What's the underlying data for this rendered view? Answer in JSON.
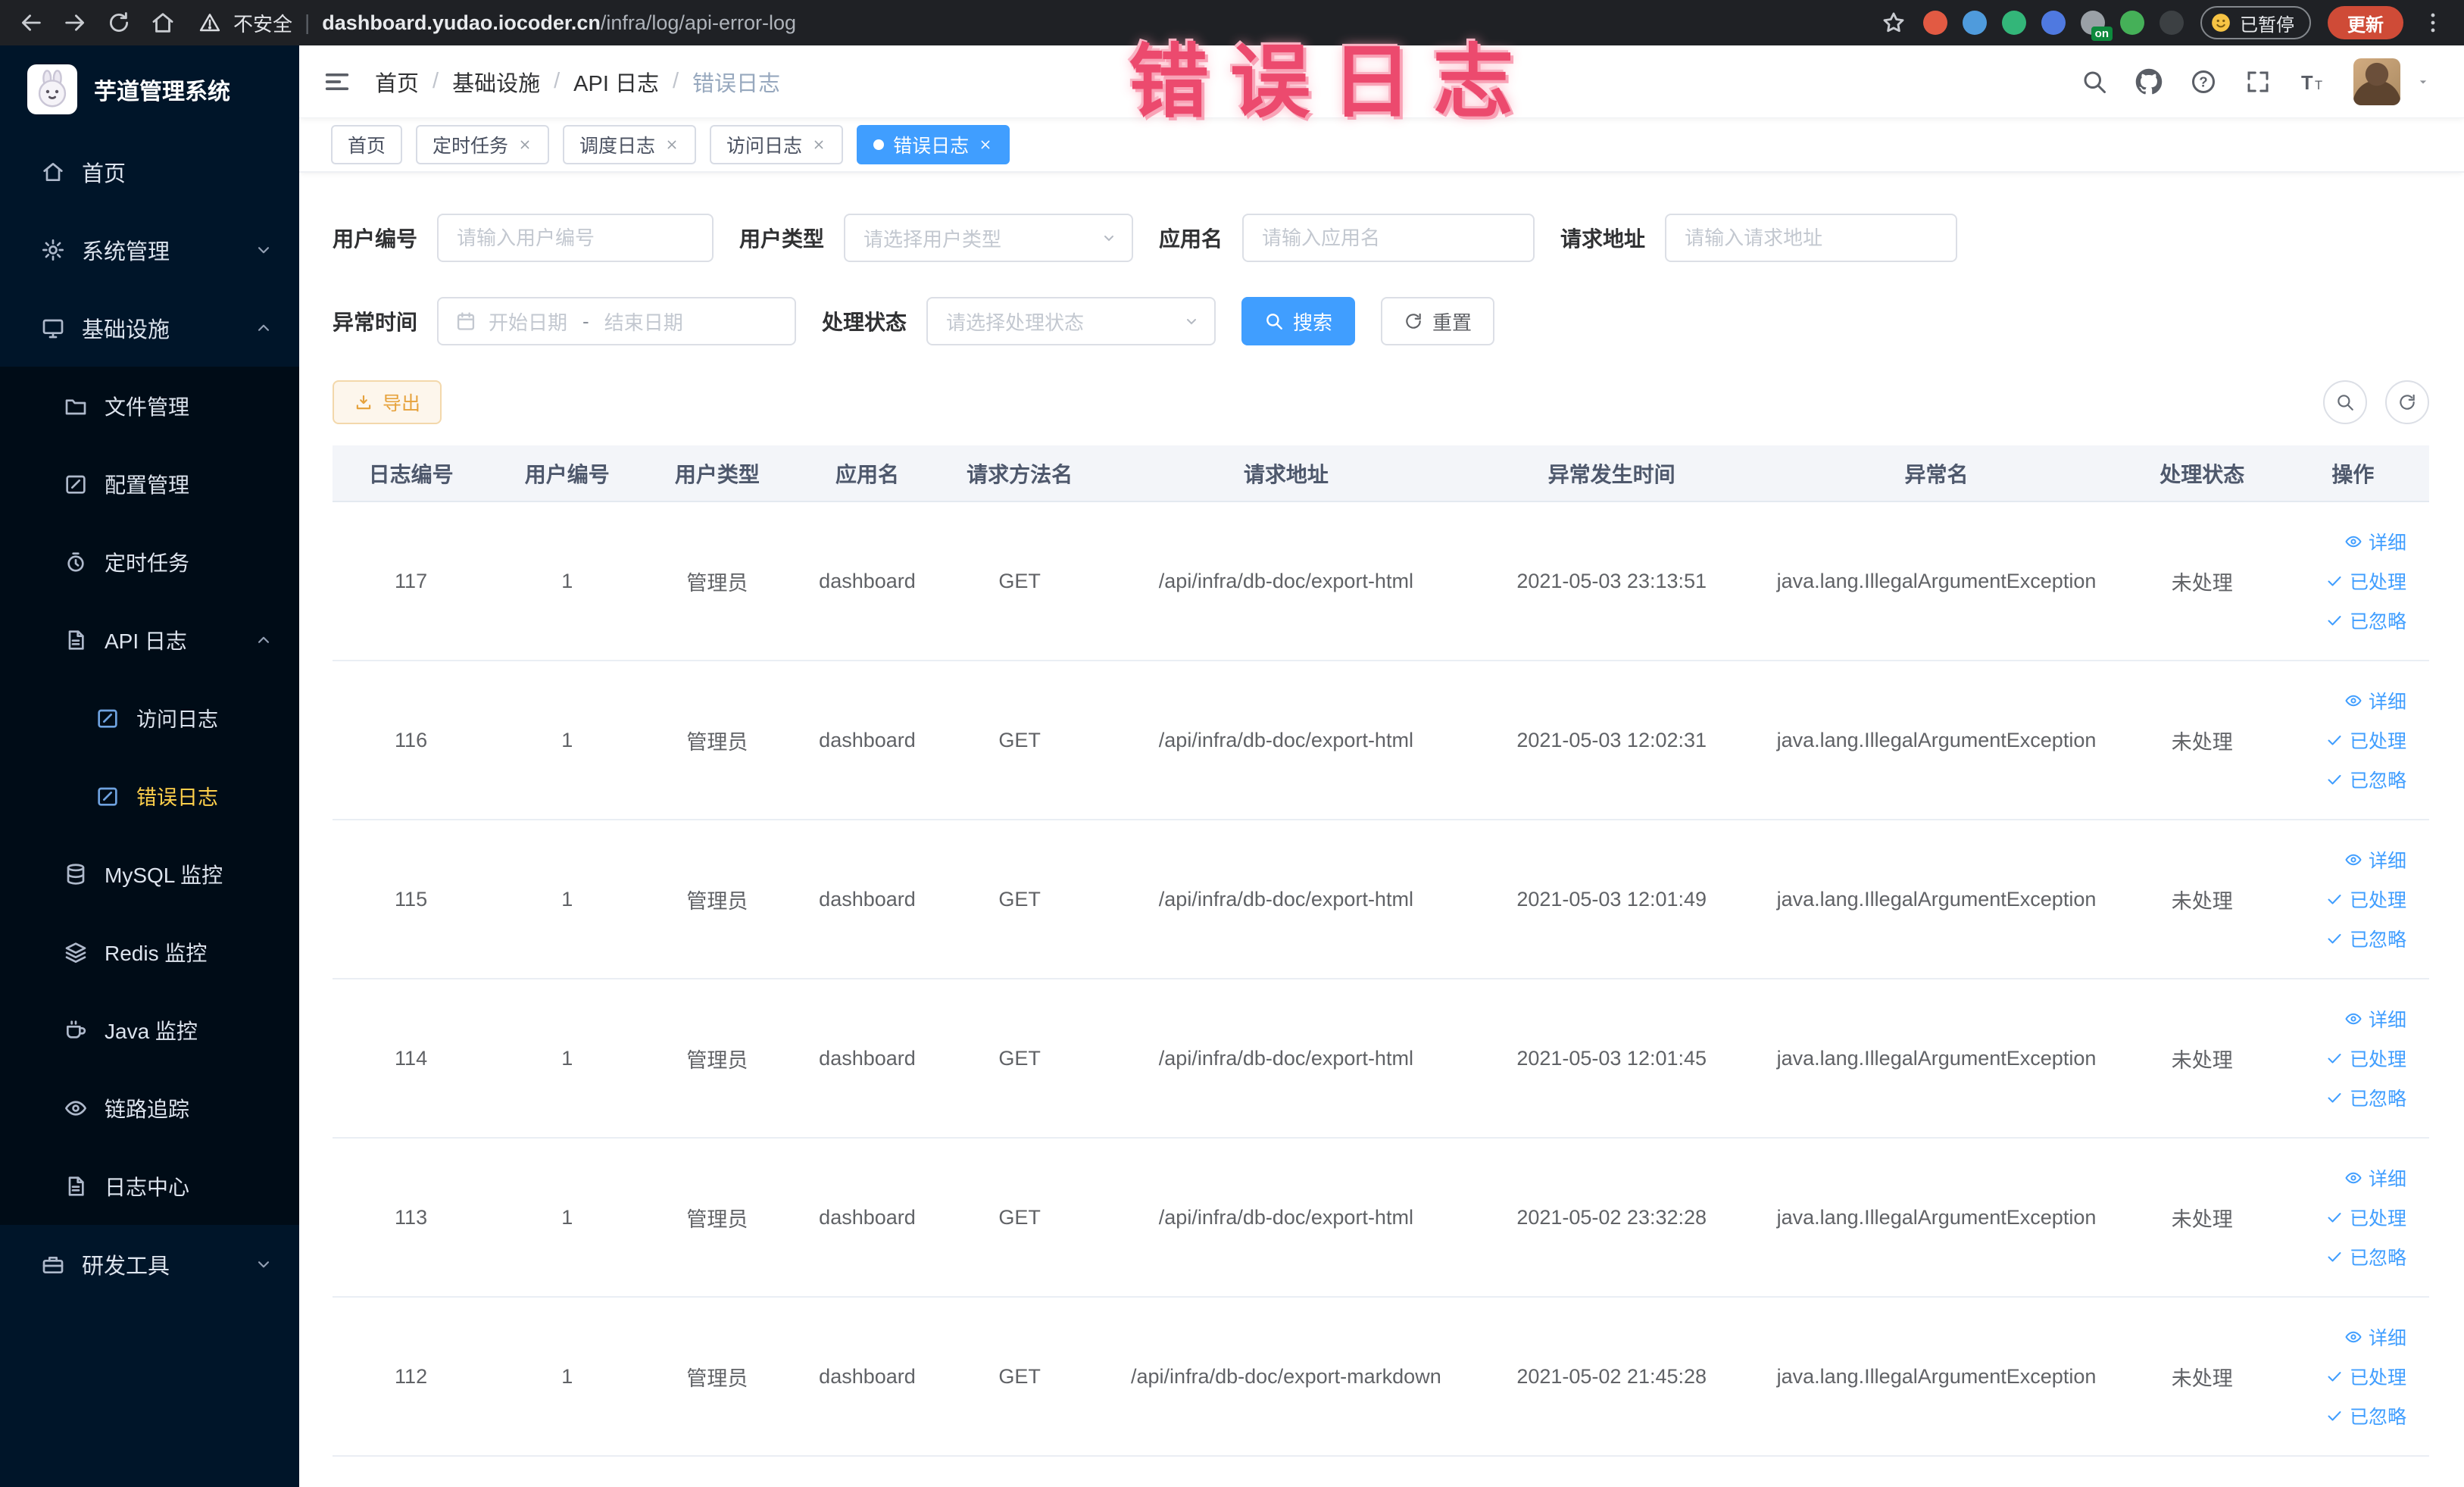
{
  "browser": {
    "security_label": "不安全",
    "divider": "|",
    "url_host": "dashboard.yudao.iocoder.cn",
    "url_path": "/infra/log/api-error-log",
    "paused_label": "已暂停",
    "update_label": "更新",
    "extensions": [
      {
        "color": "#e25a43"
      },
      {
        "color": "#4f9bdc"
      },
      {
        "color": "#33b679"
      },
      {
        "color": "#4f79e0"
      },
      {
        "color": "#9aa0a6",
        "badge": "on"
      },
      {
        "color": "#45b058"
      },
      {
        "color": "#3c4043"
      }
    ]
  },
  "annotation": {
    "text": "错误日志"
  },
  "sidebar": {
    "logo_title": "芋道管理系统",
    "items": [
      {
        "label": "首页",
        "icon": "home-icon",
        "level": 0,
        "chevron": "",
        "sub": false,
        "active": false
      },
      {
        "label": "系统管理",
        "icon": "gear-icon",
        "level": 0,
        "chevron": "down",
        "sub": false,
        "active": false
      },
      {
        "label": "基础设施",
        "icon": "monitor-icon",
        "level": 0,
        "chevron": "up",
        "sub": false,
        "active": false
      },
      {
        "label": "文件管理",
        "icon": "folder-icon",
        "level": 1,
        "chevron": "",
        "sub": true,
        "active": false
      },
      {
        "label": "配置管理",
        "icon": "edit-icon",
        "level": 1,
        "chevron": "",
        "sub": true,
        "active": false
      },
      {
        "label": "定时任务",
        "icon": "clock-icon",
        "level": 1,
        "chevron": "",
        "sub": true,
        "active": false
      },
      {
        "label": "API 日志",
        "icon": "document-icon",
        "level": 1,
        "chevron": "up",
        "sub": true,
        "active": false
      },
      {
        "label": "访问日志",
        "icon": "edit-icon",
        "level": 2,
        "chevron": "",
        "sub": true,
        "active": false,
        "icon_color": "#6fa3e0"
      },
      {
        "label": "错误日志",
        "icon": "edit-icon",
        "level": 2,
        "chevron": "",
        "sub": true,
        "active": true,
        "icon_color": "#6fa3e0"
      },
      {
        "label": "MySQL 监控",
        "icon": "database-icon",
        "level": 1,
        "chevron": "",
        "sub": true,
        "active": false
      },
      {
        "label": "Redis 监控",
        "icon": "layers-icon",
        "level": 1,
        "chevron": "",
        "sub": true,
        "active": false
      },
      {
        "label": "Java 监控",
        "icon": "coffee-icon",
        "level": 1,
        "chevron": "",
        "sub": true,
        "active": false
      },
      {
        "label": "链路追踪",
        "icon": "eye-icon",
        "level": 1,
        "chevron": "",
        "sub": true,
        "active": false
      },
      {
        "label": "日志中心",
        "icon": "document-icon",
        "level": 1,
        "chevron": "",
        "sub": true,
        "active": false
      },
      {
        "label": "研发工具",
        "icon": "toolbox-icon",
        "level": 0,
        "chevron": "down",
        "sub": false,
        "active": false
      }
    ]
  },
  "header": {
    "breadcrumbs": [
      "首页",
      "基础设施",
      "API 日志",
      "错误日志"
    ]
  },
  "tabs": [
    {
      "label": "首页",
      "closable": false,
      "active": false
    },
    {
      "label": "定时任务",
      "closable": true,
      "active": false
    },
    {
      "label": "调度日志",
      "closable": true,
      "active": false
    },
    {
      "label": "访问日志",
      "closable": true,
      "active": false
    },
    {
      "label": "错误日志",
      "closable": true,
      "active": true
    }
  ],
  "filters": {
    "user_id": {
      "label": "用户编号",
      "placeholder": "请输入用户编号"
    },
    "user_type": {
      "label": "用户类型",
      "placeholder": "请选择用户类型"
    },
    "app_name": {
      "label": "应用名",
      "placeholder": "请输入应用名"
    },
    "request_url": {
      "label": "请求地址",
      "placeholder": "请输入请求地址"
    },
    "exception_time": {
      "label": "异常时间",
      "start_placeholder": "开始日期",
      "separator": "-",
      "end_placeholder": "结束日期"
    },
    "process_status": {
      "label": "处理状态",
      "placeholder": "请选择处理状态"
    },
    "search_label": "搜索",
    "reset_label": "重置"
  },
  "toolbar": {
    "export_label": "导出"
  },
  "table": {
    "headers": [
      "日志编号",
      "用户编号",
      "用户类型",
      "应用名",
      "请求方法名",
      "请求地址",
      "异常发生时间",
      "异常名",
      "处理状态",
      "操作"
    ],
    "actions": [
      {
        "label": "详细",
        "icon": "eye-icon"
      },
      {
        "label": "已处理",
        "icon": "check-icon"
      },
      {
        "label": "已忽略",
        "icon": "check-icon"
      }
    ],
    "rows": [
      {
        "id": "117",
        "user_id": "1",
        "user_type": "管理员",
        "app": "dashboard",
        "method": "GET",
        "url": "/api/infra/db-doc/export-html",
        "time": "2021-05-03 23:13:51",
        "exception": "java.lang.IllegalArgumentException",
        "status": "未处理"
      },
      {
        "id": "116",
        "user_id": "1",
        "user_type": "管理员",
        "app": "dashboard",
        "method": "GET",
        "url": "/api/infra/db-doc/export-html",
        "time": "2021-05-03 12:02:31",
        "exception": "java.lang.IllegalArgumentException",
        "status": "未处理"
      },
      {
        "id": "115",
        "user_id": "1",
        "user_type": "管理员",
        "app": "dashboard",
        "method": "GET",
        "url": "/api/infra/db-doc/export-html",
        "time": "2021-05-03 12:01:49",
        "exception": "java.lang.IllegalArgumentException",
        "status": "未处理"
      },
      {
        "id": "114",
        "user_id": "1",
        "user_type": "管理员",
        "app": "dashboard",
        "method": "GET",
        "url": "/api/infra/db-doc/export-html",
        "time": "2021-05-03 12:01:45",
        "exception": "java.lang.IllegalArgumentException",
        "status": "未处理"
      },
      {
        "id": "113",
        "user_id": "1",
        "user_type": "管理员",
        "app": "dashboard",
        "method": "GET",
        "url": "/api/infra/db-doc/export-html",
        "time": "2021-05-02 23:32:28",
        "exception": "java.lang.IllegalArgumentException",
        "status": "未处理"
      },
      {
        "id": "112",
        "user_id": "1",
        "user_type": "管理员",
        "app": "dashboard",
        "method": "GET",
        "url": "/api/infra/db-doc/export-markdown",
        "time": "2021-05-02 21:45:28",
        "exception": "java.lang.IllegalArgumentException",
        "status": "未处理"
      }
    ]
  },
  "colors": {
    "primary": "#409eff",
    "sidebar_bg": "#001529",
    "sidebar_sub_bg": "#000c17",
    "menu_active": "#ffd04b",
    "warning": "#e6a23c",
    "annotation": "#ec4a6e",
    "update_button": "#cf4b37"
  }
}
